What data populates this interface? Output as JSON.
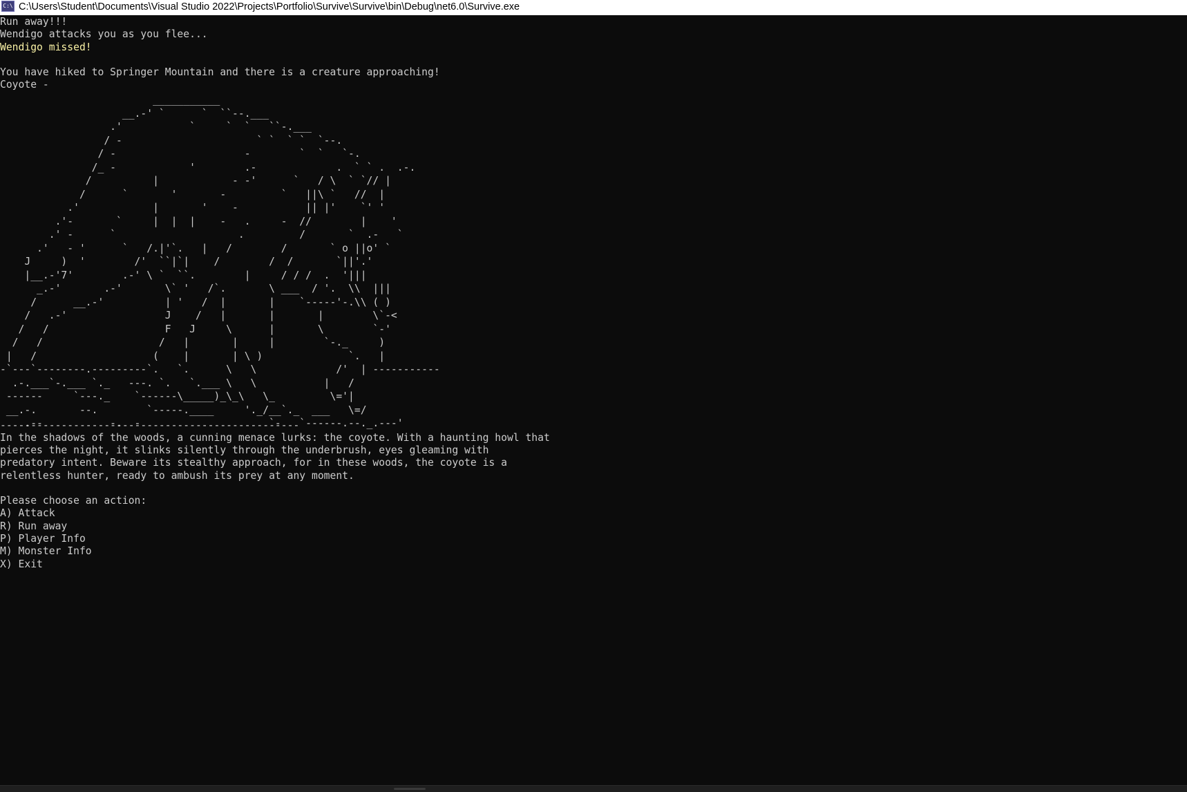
{
  "window": {
    "icon_label": "C:\\",
    "title": "C:\\Users\\Student\\Documents\\Visual Studio 2022\\Projects\\Portfolio\\Survive\\Survive\\bin\\Debug\\net6.0\\Survive.exe"
  },
  "console": {
    "log": [
      "Run away!!!",
      "Wendigo attacks you as you flee...",
      "Wendigo missed!"
    ],
    "location_message": "You have hiked to Springer Mountain and there is a creature approaching!",
    "creature_line": "Coyote -",
    "ascii_art": "                         ___________\n                    __.-' `      `  ``--.___\n                  .'           `     `  `   ``-.___\n                 / -                      ` `  ` `  `--.\n                / -                     -        `  `   `-.\n               /_ -            '        .-             .  ` ` .  .-.\n              /          |            - -'      `   / \\  ` `// |\n             /      `       '       -         `   ||\\ `   //  |\n           .'            |       '    -           || |'    `' '\n         .'-       `     |  |  |    -   .     -  //        |    '\n        .' -      `                    .         /       `  .-   `\n      .'   - '      `   /.|'`.   |   /        /       ` o ||o' `\n    J     )  '        /'  ``|`|    /        /  /       `||'.'\n    |__.-'7'        .-' \\ `  ``.        |     / / /  .  '|||\n      _.-'       .-'       \\` '   /`.       \\ ___  / '.  \\\\  |||\n     /      __.-'          | '   /  |       |    `-----'-.\\\\ ( )\n    /   .-'                J    /   |       |       |        \\`-<\n   /   /                   F   J     \\      |       \\        `-'\n  /   /                   /   |       |     |        `-._     )\n |   /                   (    |       | \\ )              `.   |\n-`---`--------.---------`.   `.      \\   \\             /'  | -----------\n  .-.___`-.___ `._   ---. `.   `.___ \\   \\           |   /\n ------     `---._    `------\\_____)_\\_\\   \\_         \\='|\n __.-.       --.        `-----.____     '._/__`._  ___   \\=/\n    .--           -.  -                     `-   `------.--._.---'",
    "separator": "-------------------------------------------------",
    "description": [
      "In the shadows of the woods, a cunning menace lurks: the coyote. With a haunting howl that",
      "pierces the night, it slinks silently through the underbrush, eyes gleaming with",
      "predatory intent. Beware its stealthy approach, for in these woods, the coyote is a",
      "relentless hunter, ready to ambush its prey at any moment."
    ],
    "prompt": "Please choose an action:",
    "menu": [
      "A) Attack",
      "R) Run away",
      "P) Player Info",
      "M) Monster Info",
      "X) Exit"
    ]
  },
  "colors": {
    "background": "#0c0c0c",
    "text": "#cccccc",
    "highlight_yellow": "#f9f1a5"
  }
}
